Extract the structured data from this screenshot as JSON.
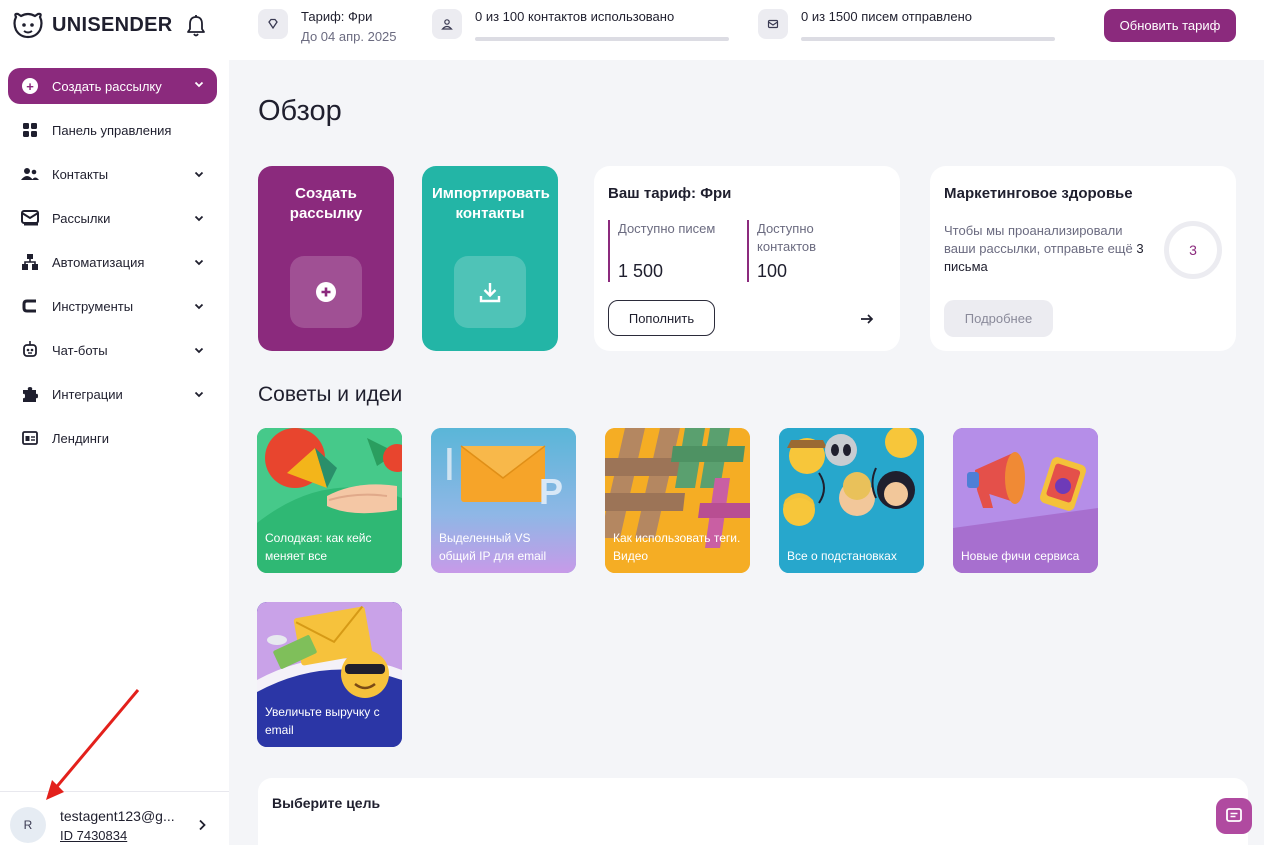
{
  "brand": {
    "name": "UNISENDER",
    "accent": "#8b2a7d",
    "teal": "#23b5a6"
  },
  "topbar": {
    "tariff_title": "Тариф: Фри",
    "tariff_until": "До 04 апр. 2025",
    "contacts_usage": "0 из 100 контактов использовано",
    "contacts_progress": 0,
    "emails_usage": "0 из 1500 писем отправлено",
    "emails_progress": 0,
    "upgrade_label": "Обновить тариф"
  },
  "sidebar": {
    "create_label": "Создать рассылку",
    "items": [
      {
        "label": "Панель управления",
        "icon": "dashboard-icon",
        "has_chevron": false
      },
      {
        "label": "Контакты",
        "icon": "contacts-icon",
        "has_chevron": true
      },
      {
        "label": "Рассылки",
        "icon": "mail-icon",
        "has_chevron": true
      },
      {
        "label": "Автоматизация",
        "icon": "automation-icon",
        "has_chevron": true
      },
      {
        "label": "Инструменты",
        "icon": "tools-icon",
        "has_chevron": true
      },
      {
        "label": "Чат-боты",
        "icon": "robot-icon",
        "has_chevron": true
      },
      {
        "label": "Интеграции",
        "icon": "puzzle-icon",
        "has_chevron": true
      },
      {
        "label": "Лендинги",
        "icon": "landing-icon",
        "has_chevron": false
      }
    ],
    "user": {
      "avatar": "R",
      "email": "testagent123@g...",
      "id": "ID 7430834"
    }
  },
  "main": {
    "title": "Обзор",
    "action_cards": [
      {
        "label": "Создать рассылку",
        "icon": "plus-icon",
        "color": "#8b2a7d"
      },
      {
        "label": "Импортировать контакты",
        "icon": "download-icon",
        "color": "#23b5a6"
      }
    ],
    "tariff": {
      "title": "Ваш тариф: Фри",
      "emails_label": "Доступно писем",
      "emails_value": "1 500",
      "contacts_label": "Доступно контактов",
      "contacts_value": "100",
      "topup_label": "Пополнить"
    },
    "health": {
      "title": "Маркетинговое здоровье",
      "text": "Чтобы мы проанализировали ваши рассылки, отправьте ещё",
      "text_bold": "3 письма",
      "score": "3",
      "more_label": "Подробнее"
    },
    "tips_title": "Советы и идеи",
    "tips": [
      {
        "caption": "Солодкая: как кейс меняет все",
        "bg": "#3fbf7f"
      },
      {
        "caption": "Выделенный VS общий IP для email",
        "bg": "#5ab0d6"
      },
      {
        "caption": "Как использовать теги. Видео",
        "bg": "#f5a623"
      },
      {
        "caption": "Все о подстановках",
        "bg": "#2aa8c9"
      },
      {
        "caption": "Новые фичи сервиса",
        "bg": "#a46bd1"
      },
      {
        "caption": "Увеличьте выручку с email",
        "bg": "#2e3aa8"
      }
    ],
    "goal_title": "Выберите цель"
  }
}
